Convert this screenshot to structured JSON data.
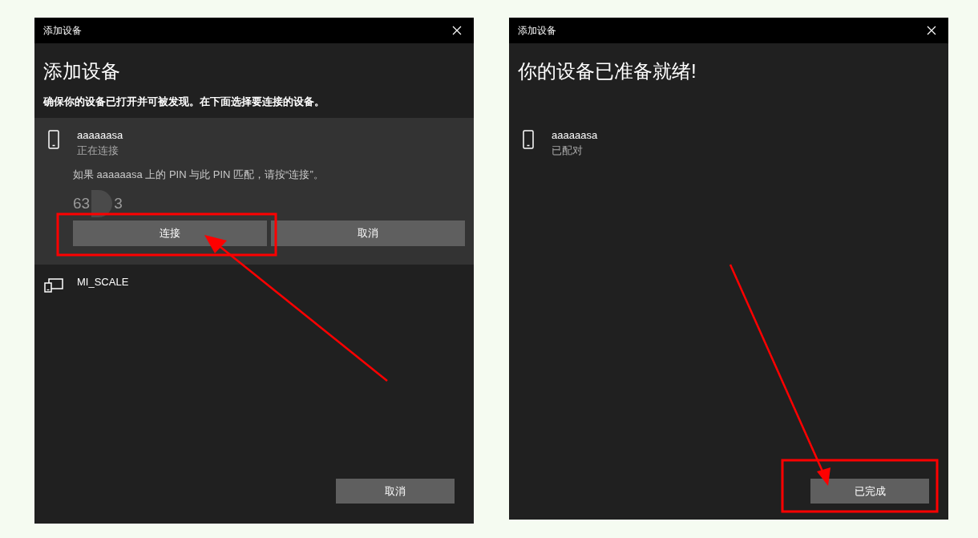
{
  "windows": [
    {
      "title": "添加设备",
      "heading": "添加设备",
      "instruction": "确保你的设备已打开并可被发现。在下面选择要连接的设备。",
      "devices": [
        {
          "kind": "phone",
          "name": "aaaaaasa",
          "status": "正在连接",
          "expanded": true,
          "prompt": "如果 aaaaaasa 上的 PIN 与此 PIN 匹配，请按“连接”。",
          "pin_parts": [
            "63",
            "3"
          ],
          "buttons": [
            "连接",
            "取消"
          ]
        },
        {
          "kind": "display",
          "name": "MI_SCALE",
          "expanded": false
        }
      ],
      "footer_button": "取消"
    },
    {
      "title": "添加设备",
      "heading": "你的设备已准备就绪!",
      "devices": [
        {
          "kind": "phone",
          "name": "aaaaaasa",
          "status": "已配对",
          "expanded": false
        }
      ],
      "footer_button": "已完成"
    }
  ]
}
